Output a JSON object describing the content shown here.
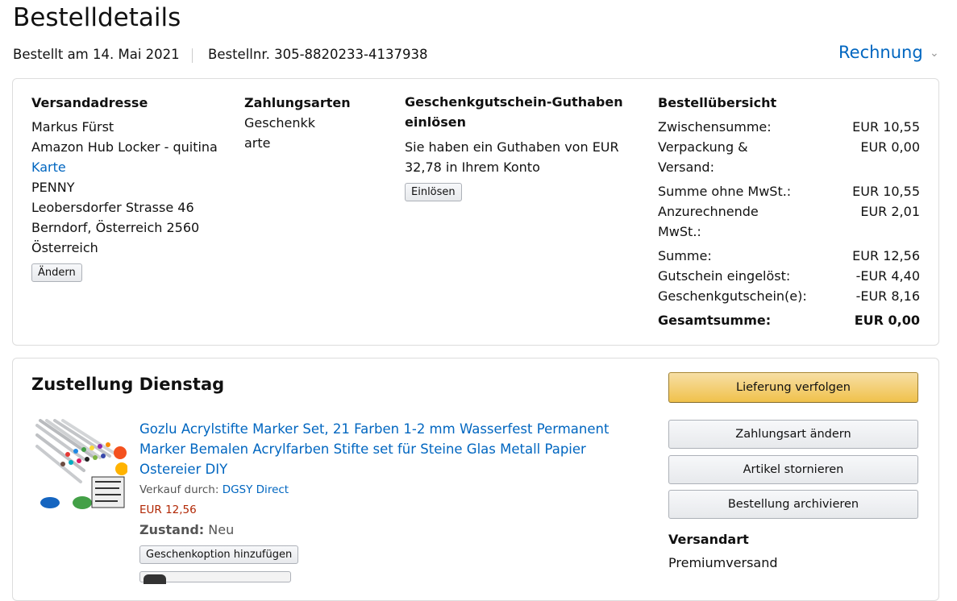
{
  "header": {
    "title": "Bestelldetails",
    "ordered_on": "Bestellt am 14. Mai 2021",
    "order_number": "Bestellnr. 305-8820233-4137938",
    "invoice_label": "Rechnung"
  },
  "shipping": {
    "heading": "Versandadresse",
    "name": "Markus Fürst",
    "line1": "Amazon Hub Locker - quitina",
    "line1_link": "Karte",
    "line2": "PENNY",
    "line3": "Leobersdorfer Strasse 46",
    "line4": "Berndorf, Österreich 2560",
    "line5": "Österreich",
    "change_button": "Ändern"
  },
  "payment": {
    "heading": "Zahlungsarten",
    "method_line1": "Geschenkk",
    "method_line2": "arte"
  },
  "giftcard": {
    "heading_line1": "Geschenkgutschein-Guthaben",
    "heading_line2": "einlösen",
    "text_line1": "Sie haben ein Guthaben von EUR",
    "text_line2": "32,78 in Ihrem Konto",
    "redeem_button": "Einlösen"
  },
  "summary": {
    "heading": "Bestellübersicht",
    "rows": [
      {
        "label": "Zwischensumme:",
        "value": "EUR 10,55"
      },
      {
        "label": "Verpackung &",
        "label2": "Versand:",
        "value": "EUR 0,00"
      },
      {
        "label": "Summe ohne MwSt.:",
        "value": "EUR 10,55"
      },
      {
        "label": "Anzurechnende",
        "label2": "MwSt.:",
        "value": "EUR 2,01"
      },
      {
        "label": "Summe:",
        "value": "EUR 12,56"
      },
      {
        "label": "Gutschein eingelöst:",
        "value": "-EUR 4,40"
      },
      {
        "label": "Geschenkgutschein(e):",
        "value": "-EUR 8,16"
      }
    ],
    "total_label": "Gesamtsumme:",
    "total_value": "EUR 0,00"
  },
  "delivery": {
    "heading": "Zustellung Dienstag",
    "product_title_line1": "Gozlu Acrylstifte Marker Set, 21 Farben 1-2 mm Wasserfest Permanent",
    "product_title_line2": "Marker Bemalen Acrylfarben Stifte set für Steine Glas Metall Papier",
    "product_title_line3": "Ostereier DIY",
    "sold_by_label": "Verkauf durch:",
    "seller": "DGSY Direct",
    "price": "EUR 12,56",
    "condition_label": "Zustand:",
    "condition_value": "Neu",
    "gift_option_button": "Geschenkoption hinzufügen"
  },
  "actions": {
    "track": "Lieferung verfolgen",
    "change_payment": "Zahlungsart ändern",
    "cancel": "Artikel stornieren",
    "archive": "Bestellung archivieren",
    "shipping_type_heading": "Versandart",
    "shipping_type_value": "Premiumversand"
  }
}
